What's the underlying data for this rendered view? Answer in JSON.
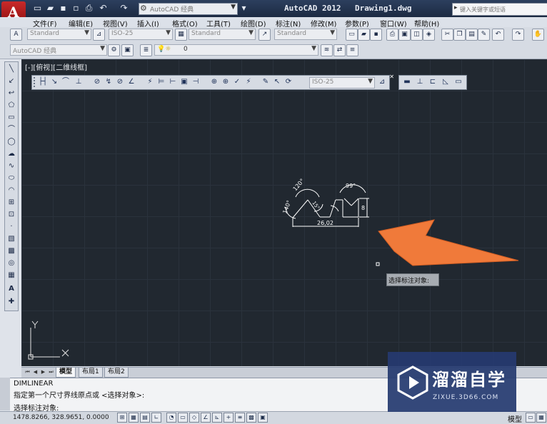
{
  "titlebar": {
    "app_name": "AutoCAD 2012",
    "document": "Drawing1.dwg",
    "workspace": "AutoCAD 经典",
    "search_placeholder": "键入关键字或短语"
  },
  "menu": [
    "文件(F)",
    "编辑(E)",
    "视图(V)",
    "插入(I)",
    "格式(O)",
    "工具(T)",
    "绘图(D)",
    "标注(N)",
    "修改(M)",
    "参数(P)",
    "窗口(W)",
    "帮助(H)"
  ],
  "styles_toolbar": {
    "text_style": "Standard",
    "dim_style": "ISO-25",
    "table_style": "Standard",
    "multileader_style": "Standard"
  },
  "layers_toolbar": {
    "workspace": "AutoCAD 经典",
    "layer": "0"
  },
  "view_label": "[-][俯视][二维线框]",
  "dim_toolbar": {
    "dim_style": "ISO-25"
  },
  "drawing": {
    "dim_angle_1": "120°",
    "dim_angle_2": "99°",
    "dim_angle_3": "140°",
    "dim_angle_4": "15°",
    "dim_horizontal": "26,02",
    "dim_vertical": "8",
    "tooltip": "选择标注对象:",
    "axis_y": "Y",
    "axis_x": "X"
  },
  "tabs": {
    "model": "模型",
    "layout1": "布局1",
    "layout2": "布局2"
  },
  "command": {
    "line1": "DIMLINEAR",
    "line2": "指定第一个尺寸界线原点或 <选择对象>:",
    "prompt": "选择标注对象:"
  },
  "status": {
    "coords": "1478.8266, 328.9651, 0.0000",
    "model_label": "模型"
  },
  "watermark": {
    "title": "溜溜自学",
    "url": "ZIXUE.3D66.COM"
  },
  "colors": {
    "canvas": "#212830",
    "titlebar": "#1c2a42",
    "arrow": "#f07a3a",
    "app_red": "#c92a2a"
  }
}
